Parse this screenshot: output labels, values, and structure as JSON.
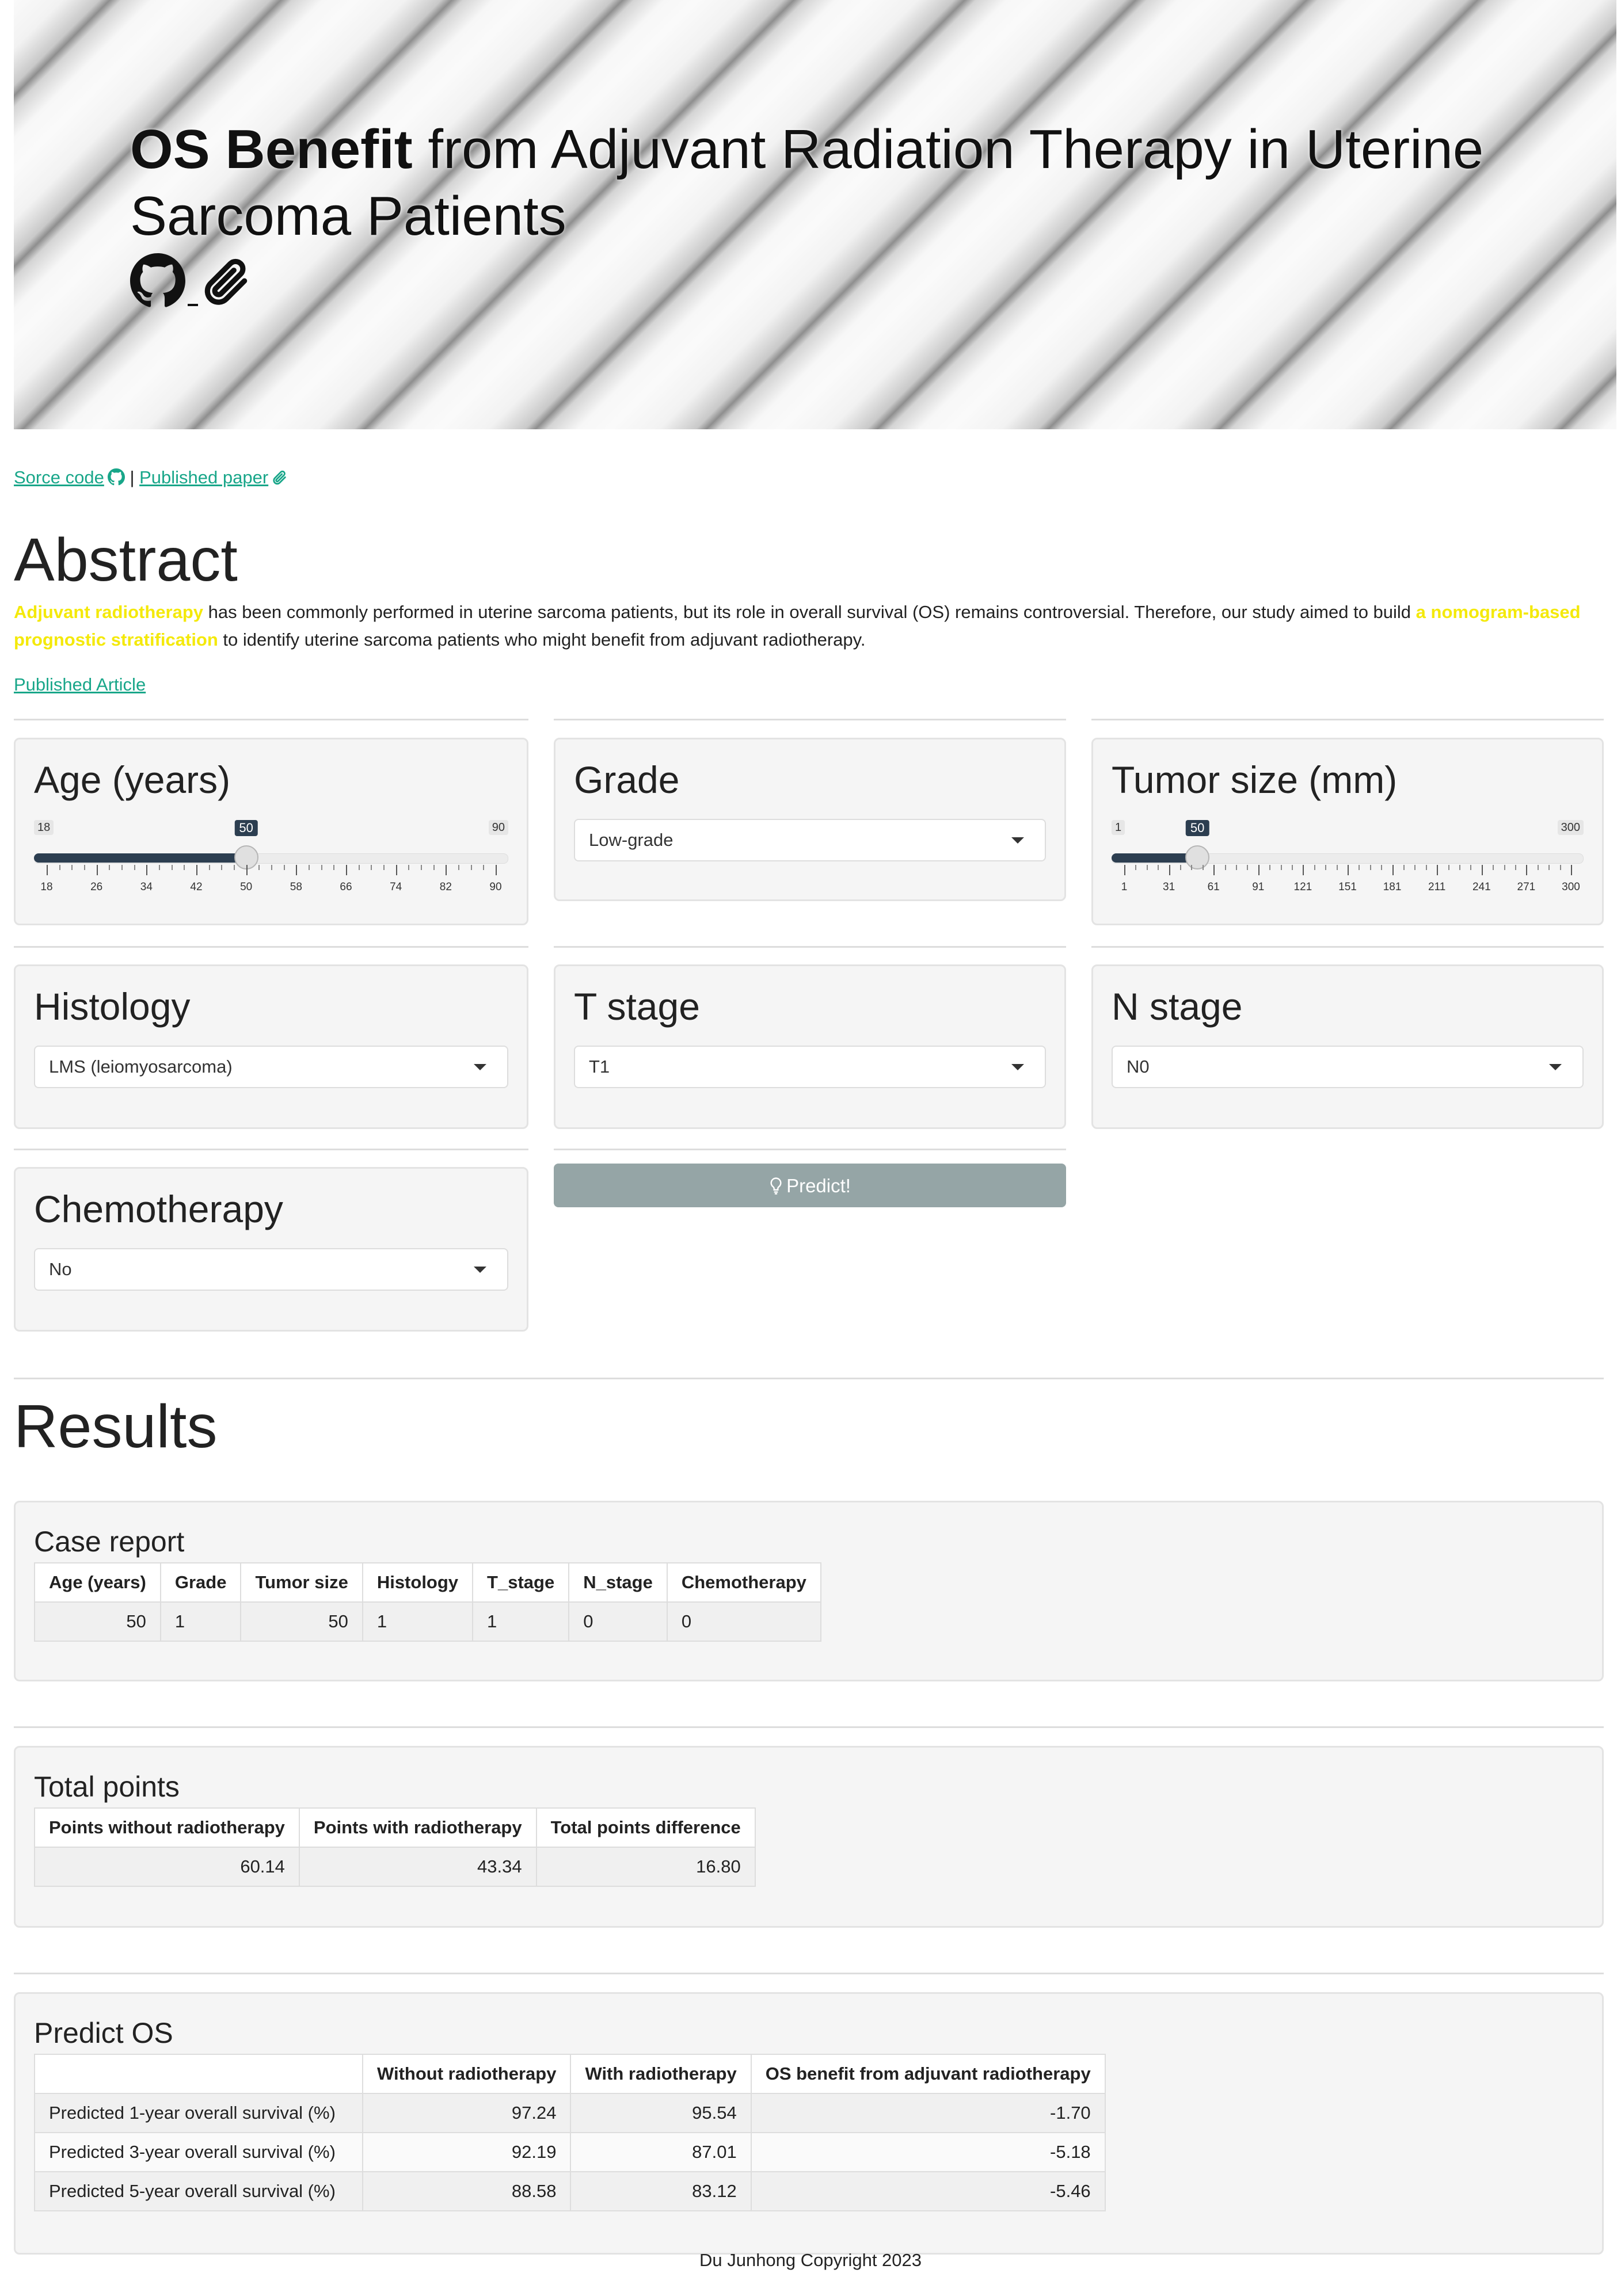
{
  "hero": {
    "title_bold": "OS Benefit",
    "title_rest": " from Adjuvant Radiation Therapy in Uterine Sarcoma Patients",
    "icons": [
      "github-icon",
      "paperclip-icon"
    ]
  },
  "links": {
    "source_label": "Sorce code",
    "separator": " | ",
    "paper_label": "Published paper"
  },
  "abstract": {
    "heading": "Abstract",
    "hl1": "Adjuvant radiotherapy",
    "text1": " has been commonly performed in uterine sarcoma patients, but its role in overall survival (OS) remains controversial. Therefore, our study aimed to build ",
    "hl2": "a nomogram-based prognostic stratification",
    "text2": " to identify uterine sarcoma patients who might benefit from adjuvant radiotherapy.",
    "article_link": "Published Article"
  },
  "inputs": {
    "age": {
      "label": "Age (years)",
      "min": 18,
      "max": 90,
      "value": 50,
      "min_label": "18",
      "max_label": "90",
      "value_label": "50",
      "ticks": [
        "18",
        "26",
        "34",
        "42",
        "50",
        "58",
        "66",
        "74",
        "82",
        "90"
      ]
    },
    "grade": {
      "label": "Grade",
      "value": "Low-grade"
    },
    "tumor_size": {
      "label": "Tumor size (mm)",
      "min": 1,
      "max": 300,
      "value": 50,
      "min_label": "1",
      "max_label": "300",
      "value_label": "50",
      "ticks": [
        "1",
        "31",
        "61",
        "91",
        "121",
        "151",
        "181",
        "211",
        "241",
        "271",
        "300"
      ]
    },
    "histology": {
      "label": "Histology",
      "value": "LMS (leiomyosarcoma)"
    },
    "t_stage": {
      "label": "T stage",
      "value": "T1"
    },
    "n_stage": {
      "label": "N stage",
      "value": "N0"
    },
    "chemotherapy": {
      "label": "Chemotherapy",
      "value": "No"
    },
    "predict_label": "Predict!"
  },
  "results": {
    "heading": "Results",
    "case_report": {
      "title": "Case report",
      "headers": [
        "Age (years)",
        "Grade",
        "Tumor size",
        "Histology",
        "T_stage",
        "N_stage",
        "Chemotherapy"
      ],
      "row": [
        "50",
        "1",
        "50",
        "1",
        "1",
        "0",
        "0"
      ]
    },
    "total_points": {
      "title": "Total points",
      "headers": [
        "Points without radiotherapy",
        "Points with radiotherapy",
        "Total points difference"
      ],
      "row": [
        "60.14",
        "43.34",
        "16.80"
      ]
    },
    "predict_os": {
      "title": "Predict OS",
      "headers": [
        "",
        "Without radiotherapy",
        "With radiotherapy",
        "OS benefit from adjuvant radiotherapy"
      ],
      "rows": [
        [
          "Predicted 1-year overall survival (%)",
          "97.24",
          "95.54",
          "-1.70"
        ],
        [
          "Predicted 3-year overall survival (%)",
          "92.19",
          "87.01",
          "-5.18"
        ],
        [
          "Predicted 5-year overall survival (%)",
          "88.58",
          "83.12",
          "-5.46"
        ]
      ]
    }
  },
  "footer": "Du Junhong Copyright 2023"
}
